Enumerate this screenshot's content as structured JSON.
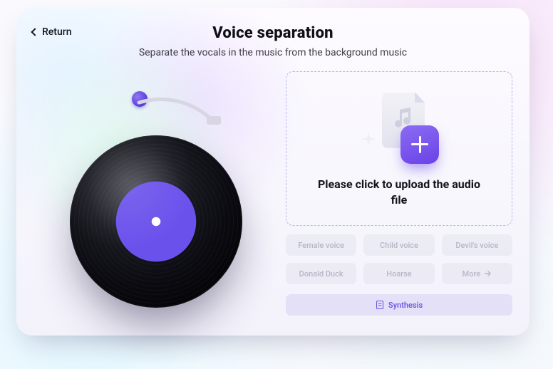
{
  "nav": {
    "return_label": "Return"
  },
  "header": {
    "title": "Voice separation",
    "subtitle": "Separate the vocals in the music from the background music"
  },
  "upload": {
    "label": "Please click to upload the audio file"
  },
  "chips": {
    "items": [
      {
        "label": "Female voice"
      },
      {
        "label": "Child voice"
      },
      {
        "label": "Devil's voice"
      },
      {
        "label": "Donald Duck"
      },
      {
        "label": "Hoarse"
      },
      {
        "label": "More",
        "more": true
      }
    ]
  },
  "synthesis": {
    "label": "Synthesis"
  }
}
